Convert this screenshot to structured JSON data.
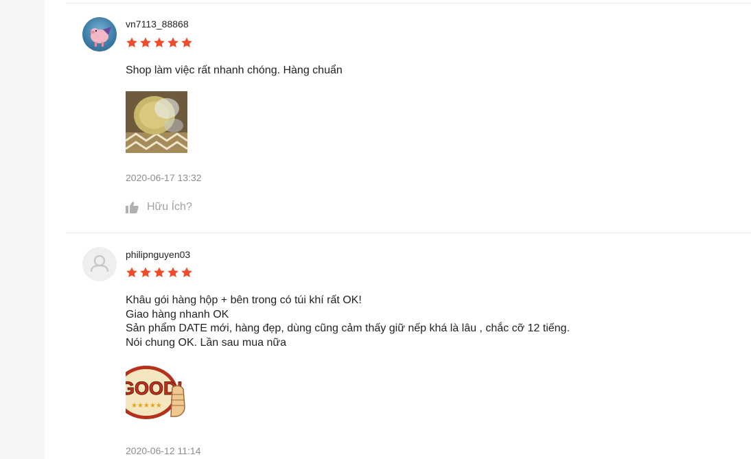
{
  "reviews": [
    {
      "username": "vn7113_88868",
      "rating": 5,
      "comment": "Shop làm việc rất nhanh chóng. Hàng chuẩn",
      "image_icon": "product-photo",
      "time": "2020-06-17 13:32",
      "helpful_label": "Hữu Ích?"
    },
    {
      "username": "philipnguyen03",
      "rating": 5,
      "comment": "Khâu gói hàng hộp + bên trong có túi khí rất OK!\nGiao hàng nhanh OK\nSản phẩm DATE mới, hàng đẹp, dùng cũng cảm thấy giữ nếp khá là lâu , chắc cỡ 12 tiếng.\nNói chung OK. Lần sau mua nữa",
      "image_icon": "good-sticker",
      "image_text": "GOOD!",
      "time": "2020-06-12 11:14"
    }
  ],
  "colors": {
    "star": "#ee4d2d",
    "muted": "#8c8c8c",
    "divider": "#e8e8e8"
  }
}
